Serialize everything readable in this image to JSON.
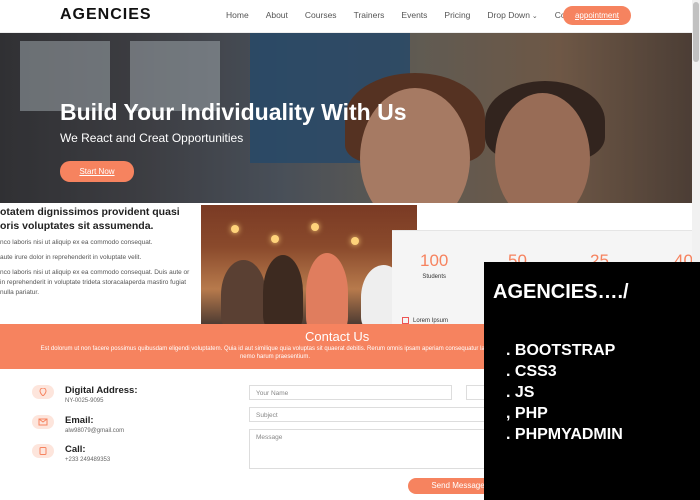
{
  "header": {
    "logo": "AGENCIES",
    "nav": [
      "Home",
      "About",
      "Courses",
      "Trainers",
      "Events",
      "Pricing",
      "Drop Down",
      "Contact"
    ],
    "appointment_label": "appointment"
  },
  "hero": {
    "title": "Build Your Individuality With Us",
    "subtitle": "We React and Creat Opportunities",
    "cta_label": "Start Now"
  },
  "about": {
    "heading": "otatem dignissimos provident quasi oris voluptates sit assumenda.",
    "lines": [
      "nco laboris nisi ut aliquip ex ea commodo consequat.",
      "aute irure dolor in reprehenderit in voluptate velit.",
      "nco laboris nisi ut aliquip ex ea commodo consequat. Duis aute or in reprehenderit in voluptate trideta storacalaperda mastiro fugiat nulla pariatur."
    ]
  },
  "stats": {
    "items": [
      {
        "num": "100",
        "label": "Students"
      },
      {
        "num": "50",
        "label": ""
      },
      {
        "num": "25",
        "label": ""
      },
      {
        "num": "40",
        "label": ""
      }
    ],
    "row_label": "Lorem Ipsum"
  },
  "contact": {
    "title": "Contact Us",
    "description": "Est dolorum ut non facere possimus quibusdam eligendi voluptatem. Quia id aut similique quia voluptas sit quaerat debitis. Rerum omnis ipsam aperiam consequatur laboriosam nemo harum praesentium.",
    "items": [
      {
        "label": "Digital Address:",
        "value": "NY-0025-9095"
      },
      {
        "label": "Email:",
        "value": "alw98079@gmail.com"
      },
      {
        "label": "Call:",
        "value": "+233 249489353"
      }
    ],
    "form": {
      "name_placeholder": "Your Name",
      "subject_placeholder": "Subject",
      "message_placeholder": "Message",
      "send_label": "Send Message"
    }
  },
  "overlay": {
    "title": "AGENCIES…./",
    "items": [
      ". BOOTSTRAP",
      ". CSS3",
      ". JS",
      ", PHP",
      ". PHPMYADMIN"
    ]
  },
  "colors": {
    "accent": "#f6835f",
    "overlay_bg": "#000000"
  }
}
